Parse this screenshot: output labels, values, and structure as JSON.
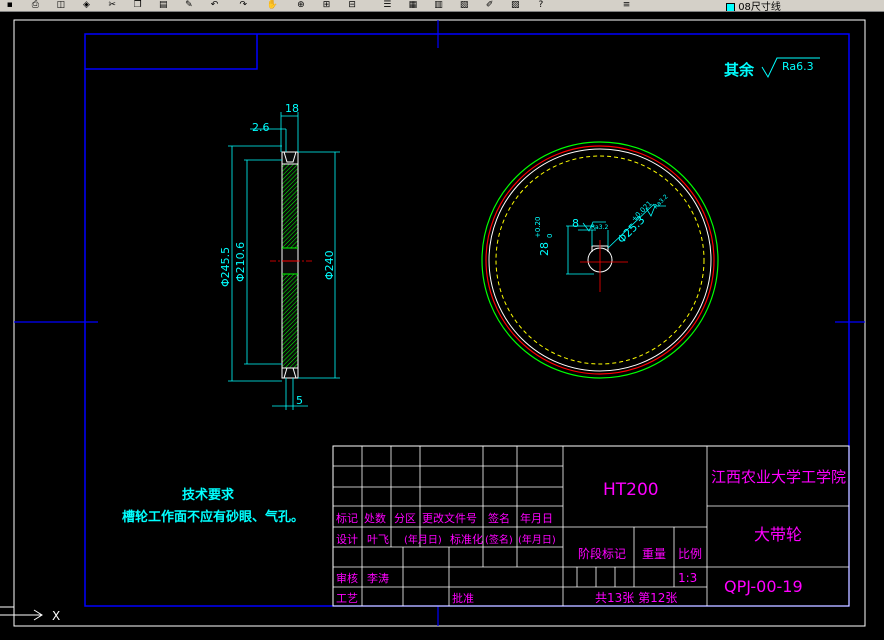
{
  "toolbar": {
    "icons": [
      "save-icon",
      "print-icon",
      "preview-icon",
      "publish-icon",
      "cut-icon",
      "copy-icon",
      "paste-icon",
      "match-icon",
      "undo-icon",
      "redo-icon",
      "pan-icon",
      "zoom-realtime-icon",
      "zoom-window-icon",
      "zoom-previous-icon",
      "properties-icon",
      "design-center-icon",
      "tool-palette-icon",
      "sheet-set-icon",
      "markup-icon",
      "calc-icon",
      "help-icon",
      "layer-icon"
    ],
    "layer_name": "08尺寸线"
  },
  "drawing": {
    "roughness_prefix": "其余",
    "roughness_value": "Ra6.3",
    "dims": {
      "width_18": "18",
      "offset_26": "2.6",
      "dia_2455": "Φ245.5",
      "dia_2106": "Φ210.6",
      "dia_240": "Φ240",
      "bottom_5": "5",
      "keyway_8": "8",
      "keyway_ra": "Ra3.2",
      "depth_28": "28",
      "depth_tol_upper": "+0.20",
      "depth_tol_lower": "0",
      "bore": "Φ25.3",
      "bore_tol": "+0.021",
      "bore_ra": "Ra3.2"
    },
    "tech_req_title": "技术要求",
    "tech_req_text": "槽轮工作面不应有砂眼、气孔。"
  },
  "title_block": {
    "material": "HT200",
    "school": "江西农业大学工学院",
    "part_name": "大带轮",
    "drawing_no": "QPJ-00-19",
    "hdr_mark": "标记",
    "hdr_count": "处数",
    "hdr_zone": "分区",
    "hdr_change_doc": "更改文件号",
    "hdr_sign": "签名",
    "hdr_date": "年月日",
    "design_label": "设计",
    "designer": "叶飞",
    "date_ph": "(年月日)",
    "standardize": "标准化",
    "sign_ph": "(签名)",
    "date_ph2": "(年月日)",
    "stage_mark": "阶段标记",
    "weight": "重量",
    "scale_label": "比例",
    "scale_value": "1:3",
    "review_label": "审核",
    "reviewer": "李涛",
    "craft_label": "工艺",
    "approve_label": "批准",
    "sheets": "共13张 第12张"
  },
  "ucs": {
    "x_label": "X"
  },
  "colors": {
    "background": "#000000",
    "frame": "#0000ff",
    "dim": "#00ffff",
    "part": "#ffffff",
    "title_text": "#ff00ff",
    "center": "#ff0000",
    "green": "#00ff00",
    "yellow": "#ffff00"
  }
}
